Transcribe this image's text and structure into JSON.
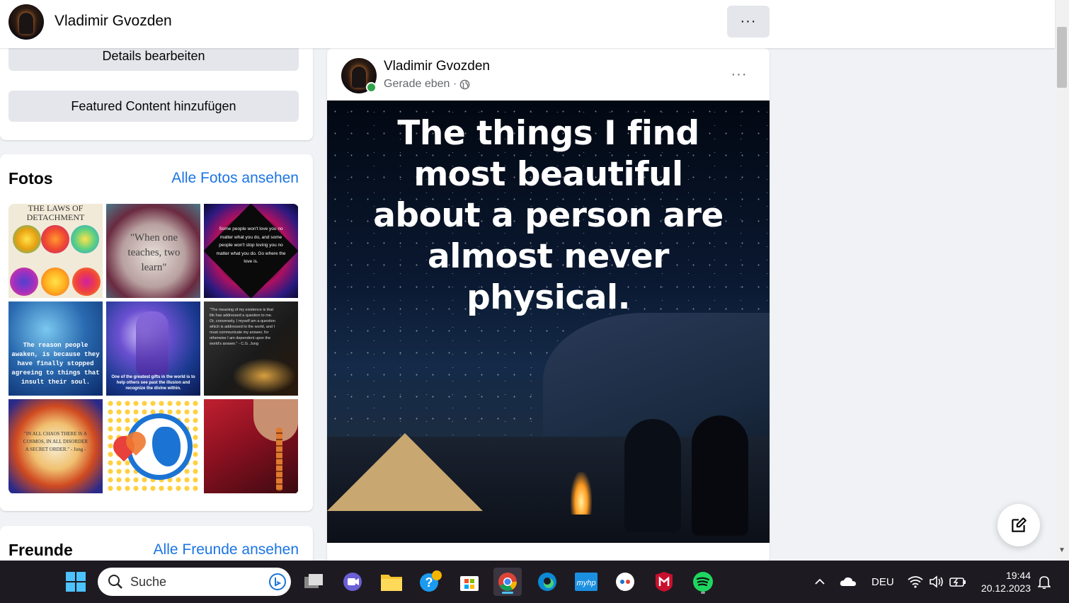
{
  "profile": {
    "name": "Vladimir Gvozden",
    "more_label": "···"
  },
  "intro": {
    "edit_details": "Details bearbeiten",
    "add_featured": "Featured Content hinzufügen"
  },
  "photos": {
    "title": "Fotos",
    "see_all": "Alle Fotos ansehen",
    "items": [
      {
        "text": "THE LAWS OF DETACHMENT"
      },
      {
        "text": "\"When one teaches, two learn\""
      },
      {
        "text": "Some people won't love you no matter what you do, and some people won't stop loving you no matter what you do. Go where the love is."
      },
      {
        "text": "The reason people awaken, is because they have finally stopped agreeing to things that insult their soul."
      },
      {
        "text": "One of the greatest gifts in the world is to help others see past the illusion and recognize the divine within."
      },
      {
        "text": "\"The meaning of my existence is that life has addressed a question to me. Or, conversely, I myself am a question which is addressed to the world, and I must communicate my answer, for otherwise I am dependent upon the world's answer.\" - C.G. Jung"
      },
      {
        "text": "\"IN ALL CHAOS THERE IS A COSMOS, IN ALL DISORDER A SECRET ORDER.\" - Jung -"
      },
      {
        "text": ""
      },
      {
        "text": ""
      }
    ]
  },
  "friends": {
    "title": "Freunde",
    "see_all": "Alle Freunde ansehen"
  },
  "post": {
    "author": "Vladimir Gvozden",
    "time": "Gerade eben ·",
    "more_label": "···",
    "image_text": "The things I find most beautiful about a person are almost never physical."
  },
  "taskbar": {
    "search_placeholder": "Suche",
    "language": "DEU",
    "time": "19:44",
    "date": "20.12.2023",
    "myhp_label": "myhp"
  },
  "colors": {
    "link": "#1b74e4",
    "button_grey": "#e4e6eb",
    "online": "#31a24c",
    "taskbar": "#1e1a22"
  }
}
